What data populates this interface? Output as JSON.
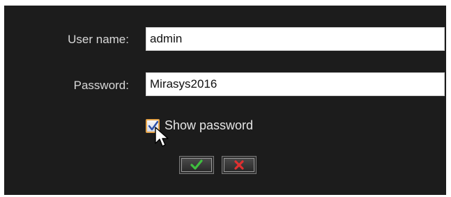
{
  "form": {
    "username_label": "User name:",
    "username_value": "admin",
    "password_label": "Password:",
    "password_value": "Mirasys2016",
    "show_password_label": "Show password",
    "show_password_checked": true
  },
  "buttons": {
    "ok_icon": "checkmark-icon",
    "cancel_icon": "x-icon"
  },
  "colors": {
    "dialog_background": "#1c1c1c",
    "ok_icon_color": "#3fbf3f",
    "cancel_icon_color": "#e03030",
    "checkbox_border": "#e7a54a"
  }
}
